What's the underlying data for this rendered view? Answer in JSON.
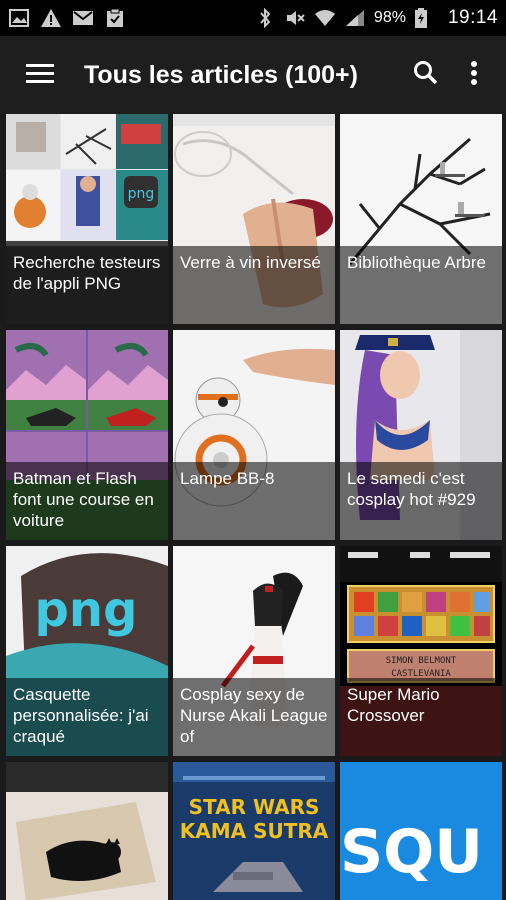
{
  "status_bar": {
    "battery": "98%",
    "time": "19:14",
    "icons": [
      "image-icon",
      "warning-icon",
      "gmail-icon",
      "clipboard-icon",
      "bluetooth-icon",
      "mute-icon",
      "wifi-icon",
      "signal-icon",
      "battery-icon"
    ]
  },
  "app_bar": {
    "title": "Tous les articles (100+)"
  },
  "colors": {
    "status_bar_bg": "#000000",
    "app_bar_bg": "#1e1e1e",
    "page_bg": "#1a1a1a"
  },
  "articles": [
    {
      "title": "Recherche testeurs de l'appli PNG"
    },
    {
      "title": "Verre à vin inversé"
    },
    {
      "title": "Bibliothèque Arbre"
    },
    {
      "title": "Batman et Flash font une course en voiture"
    },
    {
      "title": "Lampe BB-8"
    },
    {
      "title": "Le samedi c'est cosplay hot #929"
    },
    {
      "title": "Casquette personnalisée: j'ai craqué"
    },
    {
      "title": "Cosplay sexy de Nurse Akali League of"
    },
    {
      "title": "Super Mario Crossover"
    },
    {
      "title": ""
    },
    {
      "title": ""
    },
    {
      "title": ""
    }
  ],
  "thumb_text": {
    "star_wars_line1": "STAR WARS",
    "star_wars_line2": "KAMA SUTRA",
    "square_text": "SQU",
    "mario_name": "SIMON BELMONT",
    "mario_game": "CASTLEVANIA",
    "png_cap": "png",
    "png_logo": "png"
  }
}
